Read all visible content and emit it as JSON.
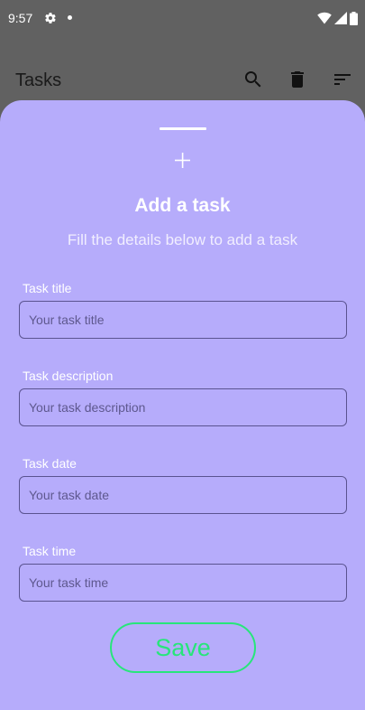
{
  "status_bar": {
    "time": "9:57",
    "icons": [
      "settings-gear-icon",
      "notification-dot-icon",
      "wifi-icon",
      "cell-signal-icon",
      "battery-icon"
    ]
  },
  "app_bar": {
    "title": "Tasks",
    "actions": [
      "search-icon",
      "delete-icon",
      "sort-icon"
    ]
  },
  "sheet": {
    "icon": "plus-icon",
    "title": "Add a task",
    "subtitle": "Fill the details below to add a task",
    "fields": {
      "title": {
        "label": "Task title",
        "placeholder": "Your task title",
        "value": ""
      },
      "description": {
        "label": "Task description",
        "placeholder": "Your task description",
        "value": ""
      },
      "date": {
        "label": "Task date",
        "placeholder": "Your task date",
        "value": ""
      },
      "time": {
        "label": "Task time",
        "placeholder": "Your task time",
        "value": ""
      }
    },
    "save_label": "Save"
  },
  "colors": {
    "scrim": "#616161",
    "sheet_background": "#b6acfb",
    "text_on_sheet": "#ffffff",
    "input_border": "#5a5390",
    "save_accent": "#27e67a"
  }
}
